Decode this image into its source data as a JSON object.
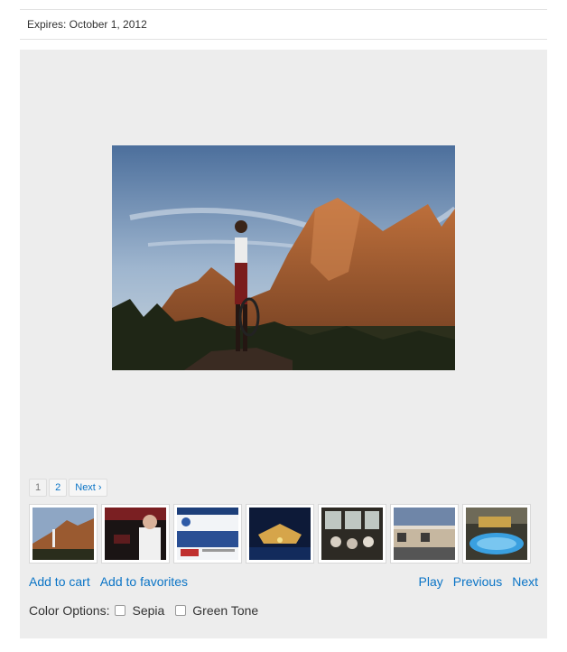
{
  "header": {
    "expires_text": "Expires: October 1, 2012"
  },
  "pagination": {
    "pages": [
      "1",
      "2"
    ],
    "current": "1",
    "next_label": "Next ›"
  },
  "thumbnails": [
    {
      "name": "thumb-mountain-hiker"
    },
    {
      "name": "thumb-speaker"
    },
    {
      "name": "thumb-website"
    },
    {
      "name": "thumb-building-night"
    },
    {
      "name": "thumb-restaurant-crowd"
    },
    {
      "name": "thumb-shopping-center"
    },
    {
      "name": "thumb-pool-resort"
    }
  ],
  "actions": {
    "add_to_cart": "Add to cart",
    "add_to_favorites": "Add to favorites",
    "play": "Play",
    "previous": "Previous",
    "next": "Next"
  },
  "color_options": {
    "label": "Color Options:",
    "sepia": "Sepia",
    "green_tone": "Green Tone"
  },
  "colors": {
    "link": "#0a74c6",
    "panel_bg": "#ededed"
  }
}
